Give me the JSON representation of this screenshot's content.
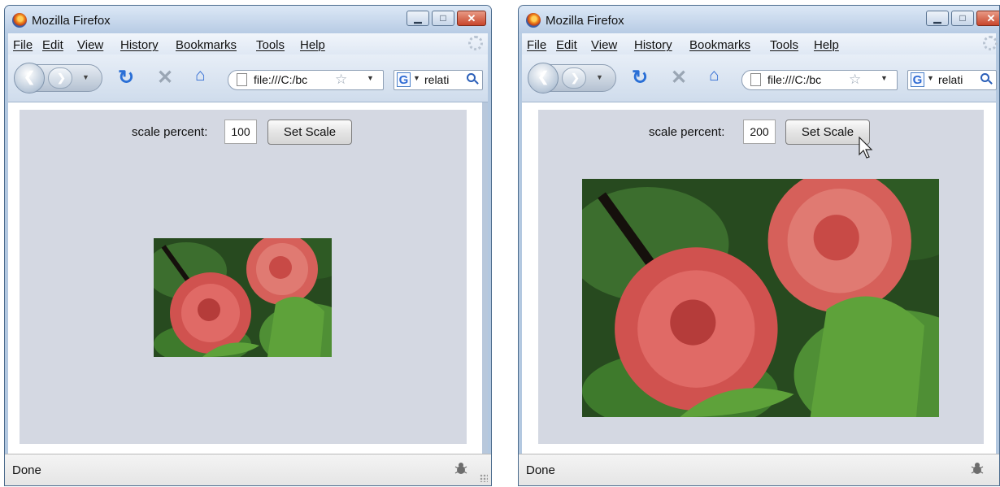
{
  "windows": [
    {
      "title": "Mozilla Firefox",
      "menu": [
        "File",
        "Edit",
        "View",
        "History",
        "Bookmarks",
        "Tools",
        "Help"
      ],
      "url": "file:///C:/bc",
      "search": "relati",
      "control": {
        "label": "scale percent:",
        "value": "100",
        "button": "Set Scale"
      },
      "status": "Done"
    },
    {
      "title": "Mozilla Firefox",
      "menu": [
        "File",
        "Edit",
        "View",
        "History",
        "Bookmarks",
        "Tools",
        "Help"
      ],
      "url": "file:///C:/bc",
      "search": "relati",
      "control": {
        "label": "scale percent:",
        "value": "200",
        "button": "Set Scale"
      },
      "status": "Done"
    }
  ],
  "icons": [
    "firefox-logo-icon",
    "minimize-icon",
    "maximize-icon",
    "close-icon",
    "back-icon",
    "forward-icon",
    "reload-icon",
    "stop-icon",
    "home-icon",
    "page-icon",
    "bookmark-star-icon",
    "google-icon",
    "search-icon",
    "firebug-icon",
    "mouse-cursor-icon"
  ],
  "colors": {
    "reload": "#2a6fd6",
    "stop": "#9aa6b4",
    "home": "#2f6bd3",
    "stage": "#d4d8e2",
    "close": "#c8462b"
  }
}
